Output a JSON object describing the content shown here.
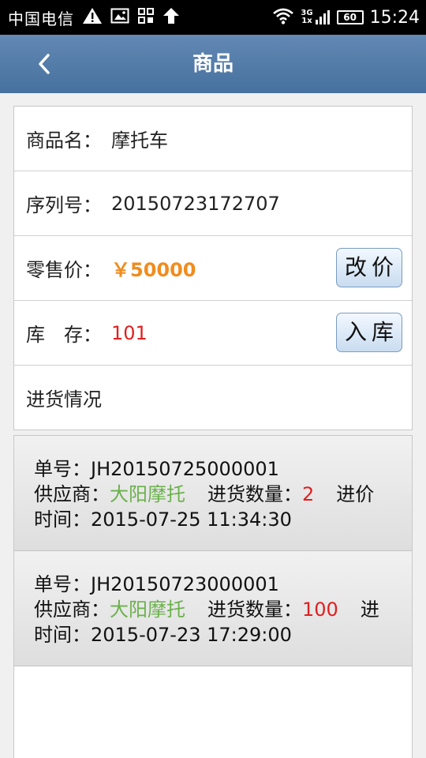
{
  "status_bar": {
    "carrier": "中国电信",
    "network_top": "3G",
    "network_bottom": "1x",
    "battery": "60",
    "time": "15:24"
  },
  "header": {
    "title": "商品"
  },
  "product": {
    "name_label": "商品名：",
    "name": "摩托车",
    "serial_label": "序列号：",
    "serial": "20150723172707",
    "price_label": "零售价：",
    "price": "￥50000",
    "change_price_button": "改价",
    "stock_label": "库　存：",
    "stock": "101",
    "stock_in_button": "入库",
    "purchase_section": "进货情况"
  },
  "purchases": [
    {
      "order_label": "单号：",
      "order_no": "JH20150725000001",
      "supplier_label": "供应商：",
      "supplier": "大阳摩托",
      "qty_label": "进货数量：",
      "qty": "2",
      "price_label": "进价",
      "time_label": "时间：",
      "time": "2015-07-25 11:34:30"
    },
    {
      "order_label": "单号：",
      "order_no": "JH20150723000001",
      "supplier_label": "供应商：",
      "supplier": "大阳摩托",
      "qty_label": "进货数量：",
      "qty": "100",
      "price_label": "进",
      "time_label": "时间：",
      "time": "2015-07-23 17:29:00"
    }
  ],
  "colors": {
    "header_bg": "#557fac",
    "price": "#f08c1e",
    "stock": "#e02020",
    "supplier": "#6ab04c"
  }
}
